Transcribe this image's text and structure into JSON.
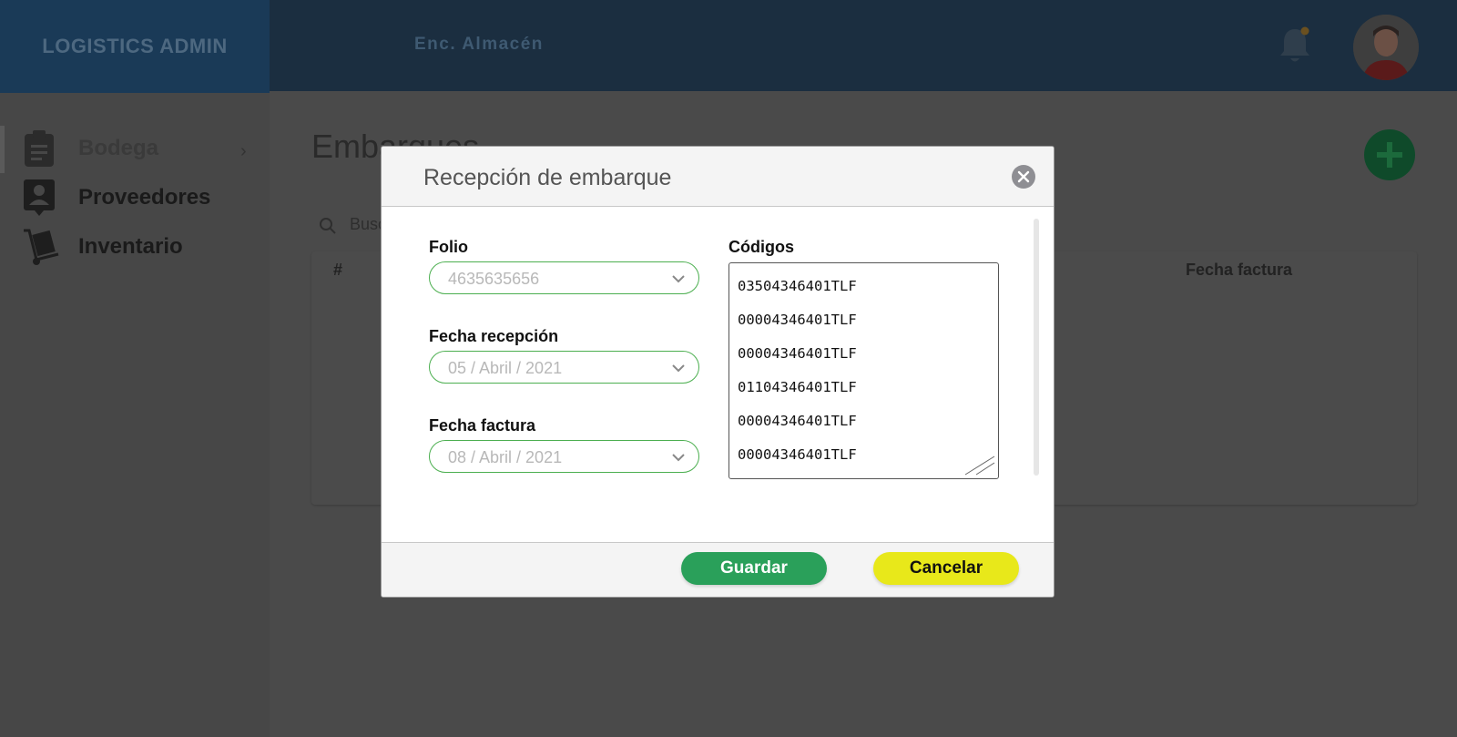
{
  "header": {
    "brand": "LOGISTICS ADMIN",
    "role": "Enc. Almacén"
  },
  "sidebar": {
    "items": [
      {
        "label": "Bodega",
        "icon": "clipboard-icon"
      },
      {
        "label": "Proveedores",
        "icon": "contact-icon"
      },
      {
        "label": "Inventario",
        "icon": "hand-truck-icon"
      }
    ]
  },
  "main": {
    "title": "Embarques",
    "search_placeholder": "Busc",
    "table_headers": [
      "#",
      "Fecha factura"
    ]
  },
  "modal": {
    "title": "Recepción de embarque",
    "fields": [
      {
        "label": "Folio",
        "value": "4635635656"
      },
      {
        "label": "Fecha recepción",
        "value": "05 / Abril / 2021"
      },
      {
        "label": "Fecha factura",
        "value": "08 / Abril / 2021"
      }
    ],
    "codes_label": "Códigos",
    "codes": [
      "03504346401TLF",
      "00004346401TLF",
      "00004346401TLF",
      "01104346401TLF",
      "00004346401TLF",
      "00004346401TLF"
    ],
    "save_label": "Guardar",
    "cancel_label": "Cancelar"
  },
  "colors": {
    "accent_green": "#2aa05a",
    "field_border": "#4caf50",
    "cancel_yellow": "#e8e81a",
    "topbar": "#1b2e40"
  }
}
